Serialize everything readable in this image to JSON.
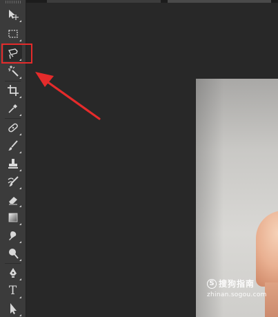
{
  "toolbar": {
    "tools": [
      {
        "icon": "move-tool-icon"
      },
      {
        "icon": "rectangular-marquee-icon"
      },
      {
        "icon": "lasso-tool-icon",
        "highlighted": true
      },
      {
        "icon": "magic-wand-icon"
      },
      {
        "icon": "crop-tool-icon"
      },
      {
        "icon": "eyedropper-icon"
      },
      {
        "icon": "healing-brush-icon"
      },
      {
        "icon": "brush-tool-icon"
      },
      {
        "icon": "clone-stamp-icon"
      },
      {
        "icon": "history-brush-icon"
      },
      {
        "icon": "eraser-icon"
      },
      {
        "icon": "gradient-tool-icon"
      },
      {
        "icon": "blur-tool-icon"
      },
      {
        "icon": "dodge-tool-icon"
      },
      {
        "icon": "pen-tool-icon"
      },
      {
        "icon": "type-tool-icon"
      },
      {
        "icon": "path-selection-icon"
      }
    ],
    "type_glyph": "T"
  },
  "annotation": {
    "highlight_color": "#e52b2b",
    "arrow_color": "#e52b2b"
  },
  "watermark": {
    "logo_letter": "S",
    "title": "搜狗指南",
    "url": "zhinan.sogou.com"
  }
}
